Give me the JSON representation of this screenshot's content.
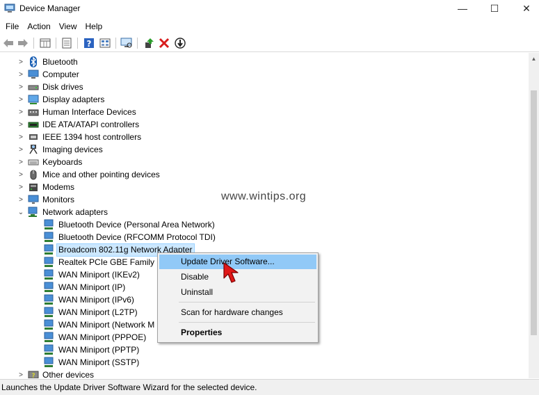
{
  "window": {
    "title": "Device Manager",
    "minimize": "—",
    "maximize": "☐",
    "close": "✕"
  },
  "menu": [
    "File",
    "Action",
    "View",
    "Help"
  ],
  "toolbar": {
    "icons": [
      "back-arrow-icon",
      "forward-arrow-icon",
      "properties-grid-icon",
      "computer-list-icon",
      "help-icon",
      "details-grid-icon",
      "monitor-scan-icon",
      "update-driver-icon",
      "uninstall-x-icon",
      "download-icon"
    ]
  },
  "tree": {
    "categories": [
      {
        "label": "Bluetooth",
        "icon": "bluetooth-icon",
        "expanded": false
      },
      {
        "label": "Computer",
        "icon": "computer-icon",
        "expanded": false
      },
      {
        "label": "Disk drives",
        "icon": "disk-drive-icon",
        "expanded": false
      },
      {
        "label": "Display adapters",
        "icon": "display-adapter-icon",
        "expanded": false
      },
      {
        "label": "Human Interface Devices",
        "icon": "hid-icon",
        "expanded": false
      },
      {
        "label": "IDE ATA/ATAPI controllers",
        "icon": "ide-controller-icon",
        "expanded": false
      },
      {
        "label": "IEEE 1394 host controllers",
        "icon": "ieee1394-icon",
        "expanded": false
      },
      {
        "label": "Imaging devices",
        "icon": "camera-icon",
        "expanded": false
      },
      {
        "label": "Keyboards",
        "icon": "keyboard-icon",
        "expanded": false
      },
      {
        "label": "Mice and other pointing devices",
        "icon": "mouse-icon",
        "expanded": false
      },
      {
        "label": "Modems",
        "icon": "modem-icon",
        "expanded": false
      },
      {
        "label": "Monitors",
        "icon": "monitor-icon",
        "expanded": false
      },
      {
        "label": "Network adapters",
        "icon": "network-adapter-icon",
        "expanded": true
      }
    ],
    "network_children": [
      {
        "label": "Bluetooth Device (Personal Area Network)",
        "selected": false
      },
      {
        "label": "Bluetooth Device (RFCOMM Protocol TDI)",
        "selected": false
      },
      {
        "label": "Broadcom 802.11g Network Adapter",
        "selected": true
      },
      {
        "label": "Realtek PCIe GBE Family Co",
        "selected": false
      },
      {
        "label": "WAN Miniport (IKEv2)",
        "selected": false
      },
      {
        "label": "WAN Miniport (IP)",
        "selected": false
      },
      {
        "label": "WAN Miniport (IPv6)",
        "selected": false
      },
      {
        "label": "WAN Miniport (L2TP)",
        "selected": false
      },
      {
        "label": "WAN Miniport (Network M",
        "selected": false
      },
      {
        "label": "WAN Miniport (PPPOE)",
        "selected": false
      },
      {
        "label": "WAN Miniport (PPTP)",
        "selected": false
      },
      {
        "label": "WAN Miniport (SSTP)",
        "selected": false
      }
    ],
    "after": [
      {
        "label": "Other devices",
        "icon": "other-devices-icon",
        "expanded": false
      }
    ]
  },
  "watermark": "www.wintips.org",
  "context_menu": {
    "update": "Update Driver Software...",
    "disable": "Disable",
    "uninstall": "Uninstall",
    "scan": "Scan for hardware changes",
    "properties": "Properties"
  },
  "status": "Launches the Update Driver Software Wizard for the selected device.",
  "colors": {
    "selection": "#cce8ff",
    "menu_highlight": "#91c9f7",
    "cursor": "#e01818"
  }
}
